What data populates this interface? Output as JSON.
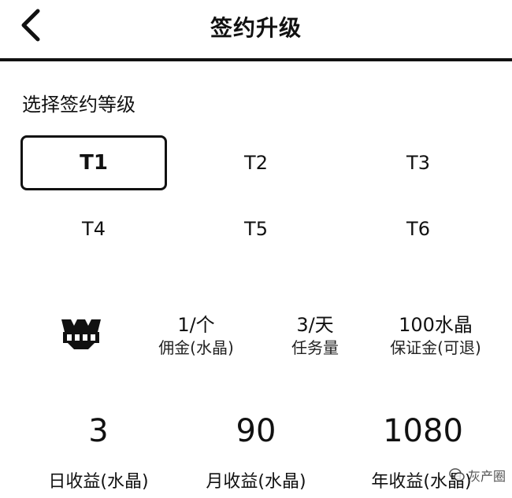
{
  "header": {
    "title": "签约升级",
    "back_icon": "chevron-left-icon"
  },
  "section_label": "选择签约等级",
  "levels": {
    "selected": "T1",
    "items": [
      "T1",
      "T2",
      "T3",
      "T4",
      "T5",
      "T6"
    ]
  },
  "level_info": {
    "badge_icon": "vip-badge-icon",
    "commission": {
      "value": "1/个",
      "label": "佣金(水晶)"
    },
    "tasks": {
      "value": "3/天",
      "label": "任务量"
    },
    "deposit": {
      "value": "100水晶",
      "label": "保证金(可退)"
    }
  },
  "earnings": {
    "daily": {
      "value": "3",
      "label": "日收益(水晶)"
    },
    "monthly": {
      "value": "90",
      "label": "月收益(水晶)"
    },
    "yearly": {
      "value": "1080",
      "label": "年收益(水晶)"
    }
  },
  "watermark": {
    "text": "灰产圈",
    "icon": "wechat-icon"
  }
}
